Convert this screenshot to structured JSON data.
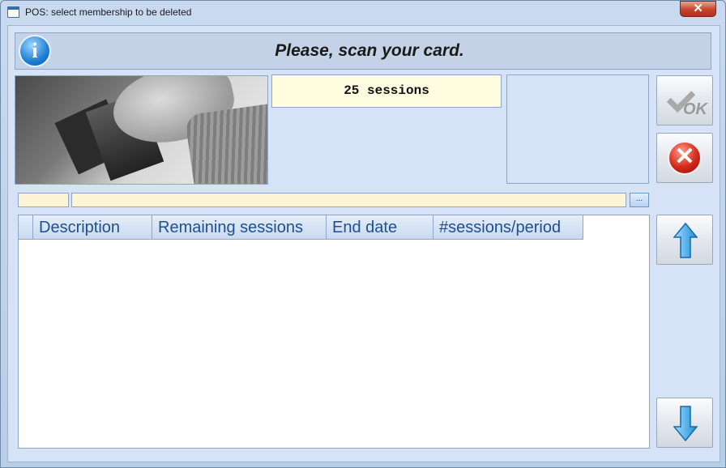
{
  "window": {
    "title": "POS: select membership to be deleted",
    "close_label": "✕"
  },
  "header": {
    "message": "Please, scan your card.",
    "info_glyph": "i"
  },
  "sessions_display": "25 sessions",
  "buttons": {
    "ok_label": "OK",
    "ellipsis_label": "..."
  },
  "grid": {
    "columns": [
      "Description",
      "Remaining sessions",
      "End date",
      "#sessions/period"
    ],
    "rows": []
  },
  "icons": {
    "ok": "checkmark-icon",
    "cancel": "red-x-circle-icon",
    "up": "arrow-up-icon",
    "down": "arrow-down-icon",
    "info": "info-icon"
  },
  "colors": {
    "header_text": "#1a1a1a",
    "grid_header_text": "#1f4f8f",
    "input_bg": "#fdf5d6",
    "sessions_bg": "#fefde0",
    "client_bg": "#d6e3f6"
  }
}
